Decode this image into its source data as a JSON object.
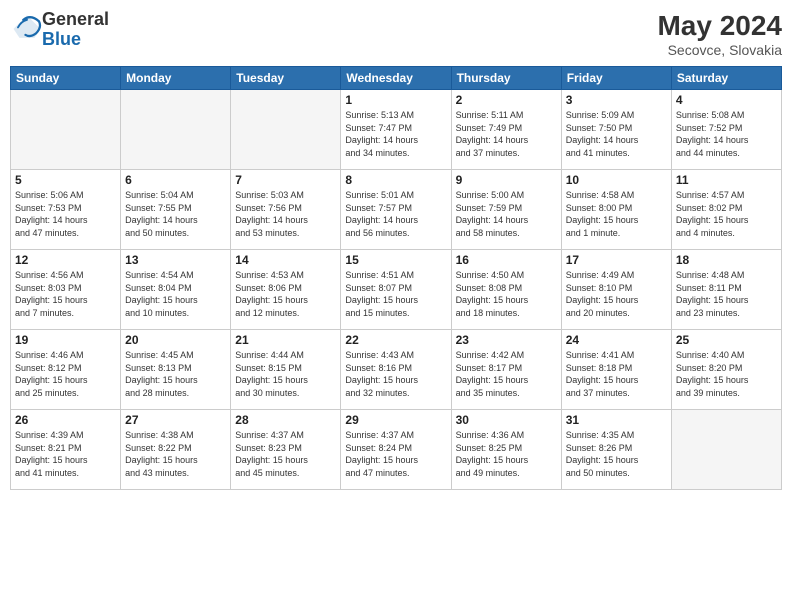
{
  "header": {
    "logo_general": "General",
    "logo_blue": "Blue",
    "month_title": "May 2024",
    "location": "Secovce, Slovakia"
  },
  "weekdays": [
    "Sunday",
    "Monday",
    "Tuesday",
    "Wednesday",
    "Thursday",
    "Friday",
    "Saturday"
  ],
  "weeks": [
    [
      {
        "day": "",
        "info": ""
      },
      {
        "day": "",
        "info": ""
      },
      {
        "day": "",
        "info": ""
      },
      {
        "day": "1",
        "info": "Sunrise: 5:13 AM\nSunset: 7:47 PM\nDaylight: 14 hours\nand 34 minutes."
      },
      {
        "day": "2",
        "info": "Sunrise: 5:11 AM\nSunset: 7:49 PM\nDaylight: 14 hours\nand 37 minutes."
      },
      {
        "day": "3",
        "info": "Sunrise: 5:09 AM\nSunset: 7:50 PM\nDaylight: 14 hours\nand 41 minutes."
      },
      {
        "day": "4",
        "info": "Sunrise: 5:08 AM\nSunset: 7:52 PM\nDaylight: 14 hours\nand 44 minutes."
      }
    ],
    [
      {
        "day": "5",
        "info": "Sunrise: 5:06 AM\nSunset: 7:53 PM\nDaylight: 14 hours\nand 47 minutes."
      },
      {
        "day": "6",
        "info": "Sunrise: 5:04 AM\nSunset: 7:55 PM\nDaylight: 14 hours\nand 50 minutes."
      },
      {
        "day": "7",
        "info": "Sunrise: 5:03 AM\nSunset: 7:56 PM\nDaylight: 14 hours\nand 53 minutes."
      },
      {
        "day": "8",
        "info": "Sunrise: 5:01 AM\nSunset: 7:57 PM\nDaylight: 14 hours\nand 56 minutes."
      },
      {
        "day": "9",
        "info": "Sunrise: 5:00 AM\nSunset: 7:59 PM\nDaylight: 14 hours\nand 58 minutes."
      },
      {
        "day": "10",
        "info": "Sunrise: 4:58 AM\nSunset: 8:00 PM\nDaylight: 15 hours\nand 1 minute."
      },
      {
        "day": "11",
        "info": "Sunrise: 4:57 AM\nSunset: 8:02 PM\nDaylight: 15 hours\nand 4 minutes."
      }
    ],
    [
      {
        "day": "12",
        "info": "Sunrise: 4:56 AM\nSunset: 8:03 PM\nDaylight: 15 hours\nand 7 minutes."
      },
      {
        "day": "13",
        "info": "Sunrise: 4:54 AM\nSunset: 8:04 PM\nDaylight: 15 hours\nand 10 minutes."
      },
      {
        "day": "14",
        "info": "Sunrise: 4:53 AM\nSunset: 8:06 PM\nDaylight: 15 hours\nand 12 minutes."
      },
      {
        "day": "15",
        "info": "Sunrise: 4:51 AM\nSunset: 8:07 PM\nDaylight: 15 hours\nand 15 minutes."
      },
      {
        "day": "16",
        "info": "Sunrise: 4:50 AM\nSunset: 8:08 PM\nDaylight: 15 hours\nand 18 minutes."
      },
      {
        "day": "17",
        "info": "Sunrise: 4:49 AM\nSunset: 8:10 PM\nDaylight: 15 hours\nand 20 minutes."
      },
      {
        "day": "18",
        "info": "Sunrise: 4:48 AM\nSunset: 8:11 PM\nDaylight: 15 hours\nand 23 minutes."
      }
    ],
    [
      {
        "day": "19",
        "info": "Sunrise: 4:46 AM\nSunset: 8:12 PM\nDaylight: 15 hours\nand 25 minutes."
      },
      {
        "day": "20",
        "info": "Sunrise: 4:45 AM\nSunset: 8:13 PM\nDaylight: 15 hours\nand 28 minutes."
      },
      {
        "day": "21",
        "info": "Sunrise: 4:44 AM\nSunset: 8:15 PM\nDaylight: 15 hours\nand 30 minutes."
      },
      {
        "day": "22",
        "info": "Sunrise: 4:43 AM\nSunset: 8:16 PM\nDaylight: 15 hours\nand 32 minutes."
      },
      {
        "day": "23",
        "info": "Sunrise: 4:42 AM\nSunset: 8:17 PM\nDaylight: 15 hours\nand 35 minutes."
      },
      {
        "day": "24",
        "info": "Sunrise: 4:41 AM\nSunset: 8:18 PM\nDaylight: 15 hours\nand 37 minutes."
      },
      {
        "day": "25",
        "info": "Sunrise: 4:40 AM\nSunset: 8:20 PM\nDaylight: 15 hours\nand 39 minutes."
      }
    ],
    [
      {
        "day": "26",
        "info": "Sunrise: 4:39 AM\nSunset: 8:21 PM\nDaylight: 15 hours\nand 41 minutes."
      },
      {
        "day": "27",
        "info": "Sunrise: 4:38 AM\nSunset: 8:22 PM\nDaylight: 15 hours\nand 43 minutes."
      },
      {
        "day": "28",
        "info": "Sunrise: 4:37 AM\nSunset: 8:23 PM\nDaylight: 15 hours\nand 45 minutes."
      },
      {
        "day": "29",
        "info": "Sunrise: 4:37 AM\nSunset: 8:24 PM\nDaylight: 15 hours\nand 47 minutes."
      },
      {
        "day": "30",
        "info": "Sunrise: 4:36 AM\nSunset: 8:25 PM\nDaylight: 15 hours\nand 49 minutes."
      },
      {
        "day": "31",
        "info": "Sunrise: 4:35 AM\nSunset: 8:26 PM\nDaylight: 15 hours\nand 50 minutes."
      },
      {
        "day": "",
        "info": ""
      }
    ]
  ]
}
